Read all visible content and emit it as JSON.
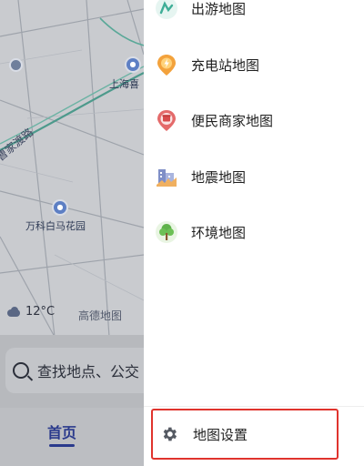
{
  "map": {
    "labels": {
      "shanghai_poi": "上海喜",
      "vanke_poi": "万科白马花园",
      "road_name": "曹家渡路"
    },
    "weather": {
      "temperature": "12°C",
      "icon": "cloud-icon"
    },
    "provider": "高德地图"
  },
  "search": {
    "placeholder": "查找地点、公交"
  },
  "bottom_nav": {
    "active_tab": "首页"
  },
  "drawer": {
    "menu_items": [
      {
        "label": "出游地图",
        "icon": "travel-map-icon"
      },
      {
        "label": "充电站地图",
        "icon": "charging-station-icon"
      },
      {
        "label": "便民商家地图",
        "icon": "merchant-icon"
      },
      {
        "label": "地震地图",
        "icon": "earthquake-icon"
      },
      {
        "label": "环境地图",
        "icon": "environment-tree-icon"
      }
    ],
    "settings": {
      "label": "地图设置",
      "icon": "gear-icon"
    }
  },
  "colors": {
    "highlight_border": "#e0332d",
    "active_tab": "#2a3a8c"
  }
}
